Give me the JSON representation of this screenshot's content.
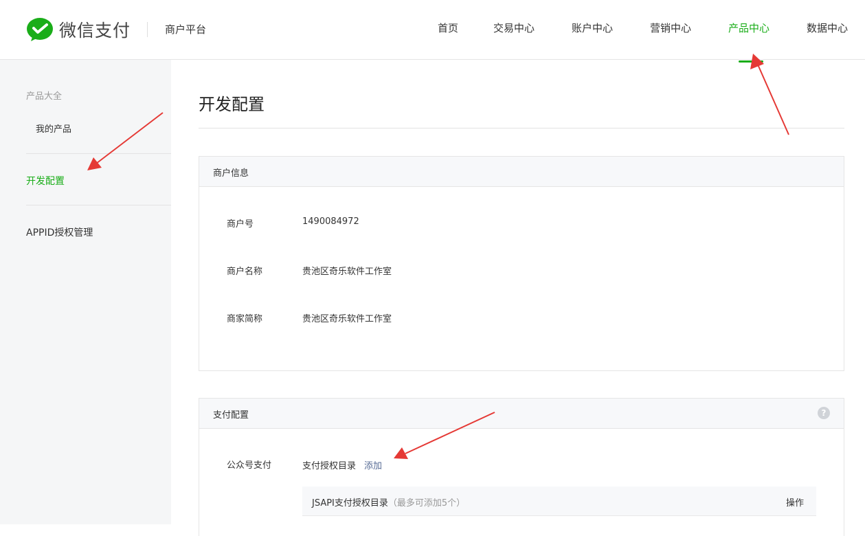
{
  "header": {
    "logo_text": "微信支付",
    "platform": "商户平台",
    "nav": [
      "首页",
      "交易中心",
      "账户中心",
      "营销中心",
      "产品中心",
      "数据中心"
    ],
    "active_nav": "产品中心"
  },
  "sidebar": {
    "group_title": "产品大全",
    "sub_item": "我的产品",
    "items": [
      "开发配置",
      "APPID授权管理"
    ]
  },
  "main": {
    "page_title": "开发配置",
    "merchant_panel": {
      "title": "商户信息",
      "rows": [
        {
          "label": "商户号",
          "value": "1490084972"
        },
        {
          "label": "商户名称",
          "value": "贵池区奇乐软件工作室"
        },
        {
          "label": "商家简称",
          "value": "贵池区奇乐软件工作室"
        }
      ]
    },
    "payment_panel": {
      "title": "支付配置",
      "help": "?",
      "row_label": "公众号支付",
      "row_value": "支付授权目录",
      "add_link": "添加",
      "jsapi_title": "JSAPI支付授权目录",
      "jsapi_note": "（最多可添加5个）",
      "jsapi_op": "操作"
    }
  },
  "colors": {
    "brand_green": "#1aad19",
    "link_blue": "#576b95",
    "arrow_red": "#e53935"
  }
}
